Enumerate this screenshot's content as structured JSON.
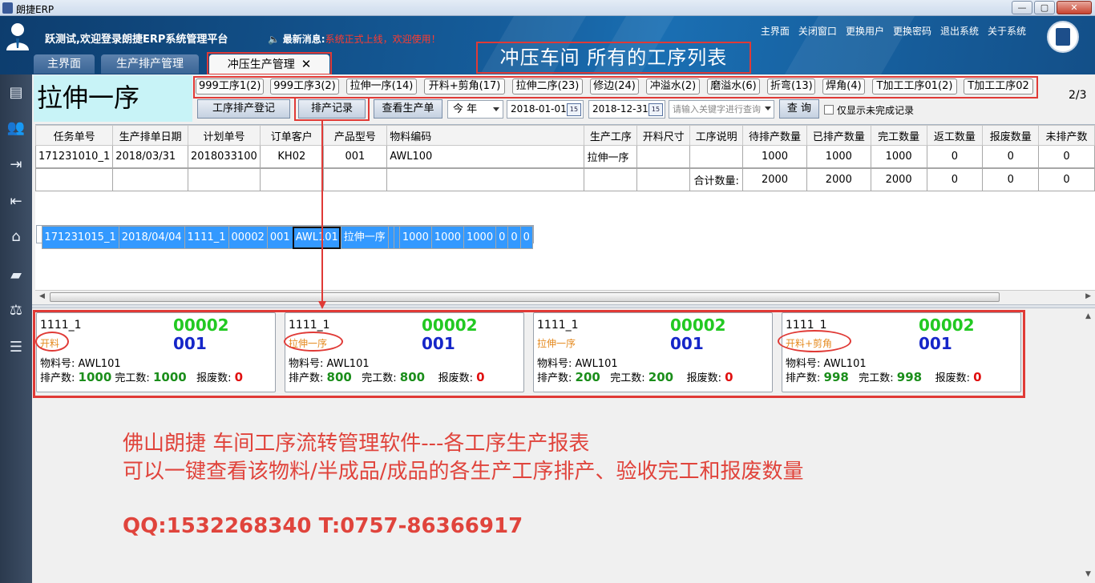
{
  "window": {
    "title": "朗捷ERP",
    "buttons": [
      "—",
      "▢",
      "✕"
    ]
  },
  "header": {
    "welcome": "跃测试,欢迎登录朗捷ERP系统管理平台",
    "news_label": "最新消息:",
    "news_text": "系统正式上线，欢迎使用！",
    "links": [
      "主界面",
      "关闭窗口",
      "更换用户",
      "更换密码",
      "退出系统",
      "关于系统"
    ],
    "overlay_title": "冲压车间 所有的工序列表"
  },
  "tabs": [
    {
      "label": "主界面"
    },
    {
      "label": "生产排产管理"
    },
    {
      "label": "冲压生产管理",
      "close": "✕"
    }
  ],
  "sidebar": {
    "icons": [
      "document-icon",
      "users-icon",
      "truck-out-icon",
      "truck-in-icon",
      "warehouse-icon",
      "factory-icon",
      "scale-icon",
      "report-icon"
    ]
  },
  "current_process": "拉伸一序",
  "process_chips": [
    "999工序1(2)",
    "999工序3(2)",
    "拉伸一序(14)",
    "开料+剪角(17)",
    "拉伸二序(23)",
    "修边(24)",
    "冲溢水(2)",
    "磨溢水(6)",
    "折弯(13)",
    "焊角(4)",
    "T加工工序01(2)",
    "T加工工序02"
  ],
  "page_indicator": "2/3",
  "toolbar": {
    "register": "工序排产登记",
    "records": "排产记录",
    "view_orders": "查看生产单",
    "period": "今 年",
    "date_from": "2018-01-01",
    "date_to": "2018-12-31",
    "cal_icon": "15",
    "search_placeholder": "请输入关键字进行查询",
    "query": "查 询",
    "only_unfinished": "仅显示未完成记录"
  },
  "table": {
    "columns": [
      "任务单号",
      "生产排单日期",
      "计划单号",
      "订单客户",
      "产品型号",
      "物料编码",
      "生产工序",
      "开料尺寸",
      "工序说明",
      "待排产数量",
      "已排产数量",
      "完工数量",
      "返工数量",
      "报废数量",
      "未排产数"
    ],
    "rows": [
      [
        "171231010_1",
        "2018/03/31",
        "2018033100",
        "KH02",
        "001",
        "AWL100",
        "拉伸一序",
        "",
        "",
        "1000",
        "1000",
        "1000",
        "0",
        "0",
        "0"
      ],
      [
        "171231015_1",
        "2018/04/04",
        "1111_1",
        "00002",
        "001",
        "AWL101",
        "拉伸一序",
        "",
        "",
        "1000",
        "1000",
        "1000",
        "0",
        "0",
        "0"
      ]
    ],
    "total_label": "合计数量:",
    "totals": [
      "2000",
      "2000",
      "2000",
      "0",
      "0",
      "0"
    ]
  },
  "cards": [
    {
      "job": "1111_1",
      "customer": "00002",
      "product": "001",
      "process": "开料",
      "material_label": "物料号:",
      "material": "AWL101",
      "scheduled_label": "排产数:",
      "scheduled": "1000",
      "done_label": "完工数:",
      "done": "1000",
      "scrap_label": "报废数:",
      "scrap": "0"
    },
    {
      "job": "1111_1",
      "customer": "00002",
      "product": "001",
      "process": "拉伸一序",
      "material_label": "物料号:",
      "material": "AWL101",
      "scheduled_label": "排产数:",
      "scheduled": "800",
      "done_label": "完工数:",
      "done": "800",
      "scrap_label": "报废数:",
      "scrap": "0"
    },
    {
      "job": "1111_1",
      "customer": "00002",
      "product": "001",
      "process": "拉伸一序",
      "material_label": "物料号:",
      "material": "AWL101",
      "scheduled_label": "排产数:",
      "scheduled": "200",
      "done_label": "完工数:",
      "done": "200",
      "scrap_label": "报废数:",
      "scrap": "0"
    },
    {
      "job": "1111_1",
      "customer": "00002",
      "product": "001",
      "process": "开料+剪角",
      "material_label": "物料号:",
      "material": "AWL101",
      "scheduled_label": "排产数:",
      "scheduled": "998",
      "done_label": "完工数:",
      "done": "998",
      "scrap_label": "报废数:",
      "scrap": "0"
    }
  ],
  "notes": [
    "佛山朗捷 车间工序流转管理软件---各工序生产报表",
    "可以一键查看该物料/半成品/成品的各生产工序排产、验收完工和报废数量",
    "QQ:1532268340  T:0757-86366917"
  ],
  "colors": {
    "accent_red": "#e03a36",
    "selected_row": "#3399ff",
    "customer_green": "#22c922",
    "product_blue": "#1526c8",
    "process_orange": "#e58a1f"
  }
}
